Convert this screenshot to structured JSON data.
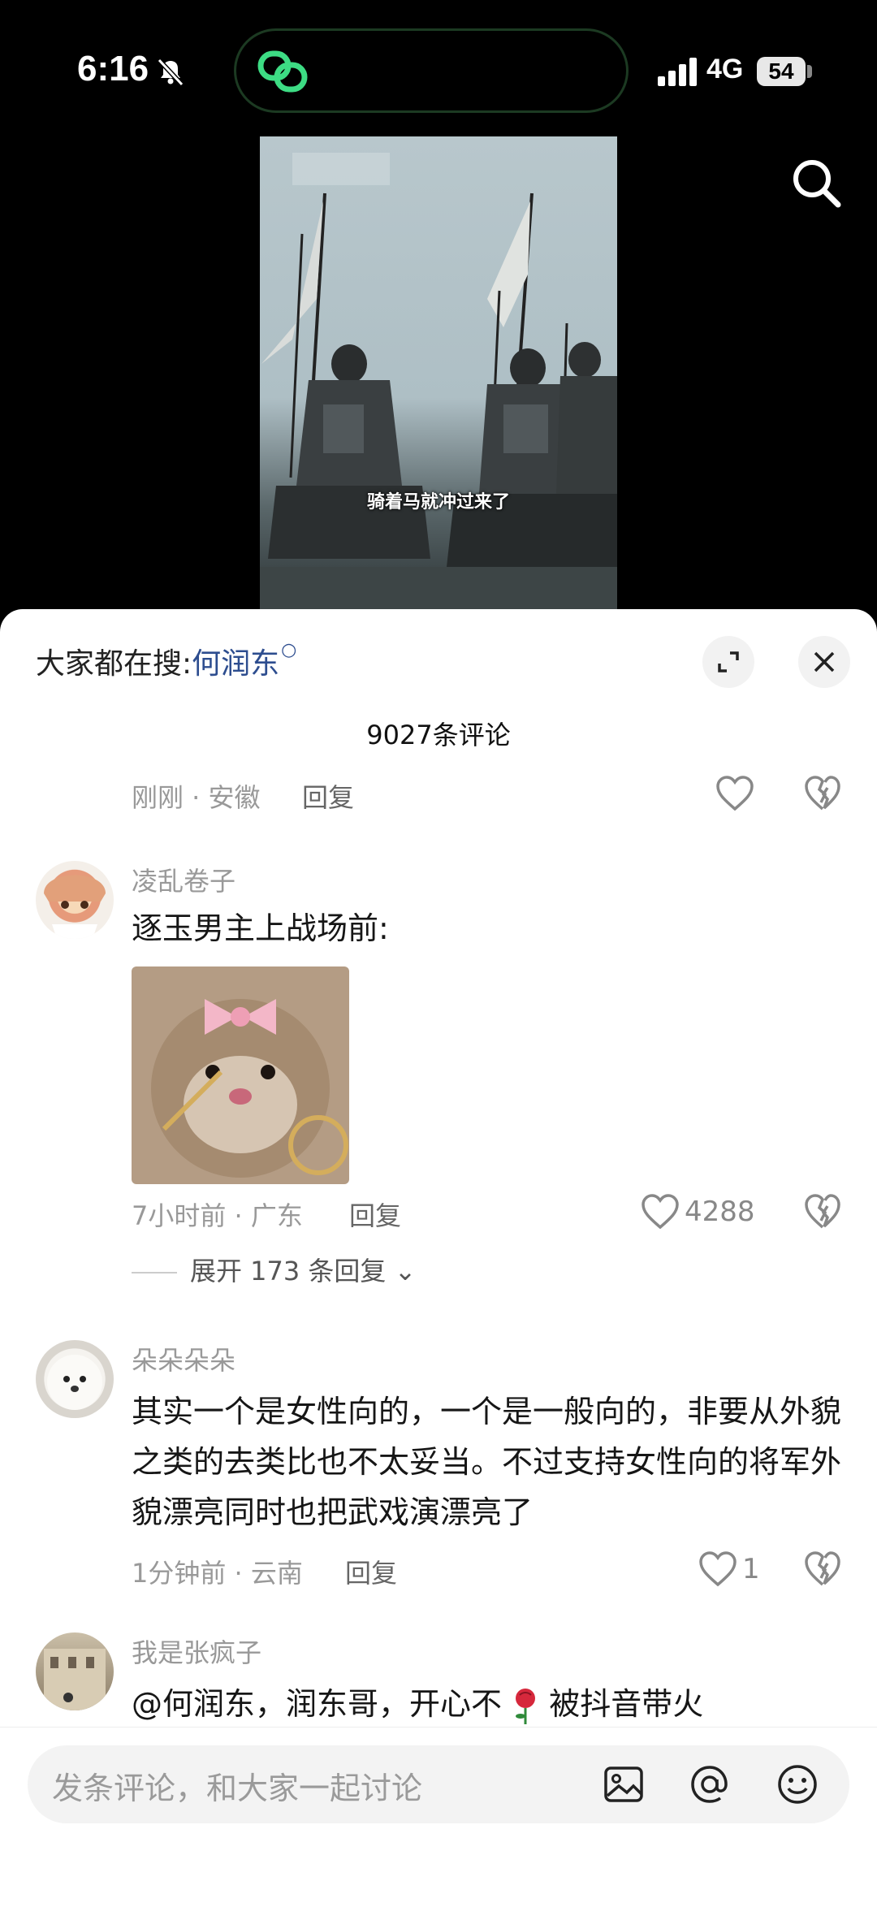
{
  "status": {
    "time": "6:16",
    "network": "4G",
    "battery": "54"
  },
  "video": {
    "subtitle": "骑着马就冲过来了"
  },
  "sheet": {
    "hot_search_prefix": "大家都在搜:",
    "hot_search_term": "何润东",
    "comment_count": "9027条评论",
    "first_meta": {
      "time_location": "刚刚 · 安徽",
      "reply": "回复"
    },
    "comments": [
      {
        "username": "凌乱卷子",
        "text": "逐玉男主上战场前:",
        "time_location": "7小时前 · 广东",
        "reply": "回复",
        "likes": "4288",
        "expand_replies": "展开 173 条回复"
      },
      {
        "username": "朵朵朵朵",
        "text": "其实一个是女性向的，一个是一般向的，非要从外貌之类的去类比也不太妥当。不过支持女性向的将军外貌漂亮同时也把武戏演漂亮了",
        "time_location": "1分钟前 · 云南",
        "reply": "回复",
        "likes": "1"
      },
      {
        "username": "我是张疯子",
        "text_before": "@何润东，润东哥，开心不",
        "text_after": "被抖音带火"
      }
    ]
  },
  "input": {
    "placeholder": "发条评论，和大家一起讨论"
  },
  "icons": {
    "status_bell": "bell-muted-icon",
    "island": "link-loop-icon",
    "search": "search-icon",
    "expand": "expand-icon",
    "close": "close-icon",
    "like": "heart-icon",
    "dislike": "broken-heart-icon",
    "image": "image-icon",
    "mention": "at-icon",
    "emoji": "emoji-icon"
  }
}
